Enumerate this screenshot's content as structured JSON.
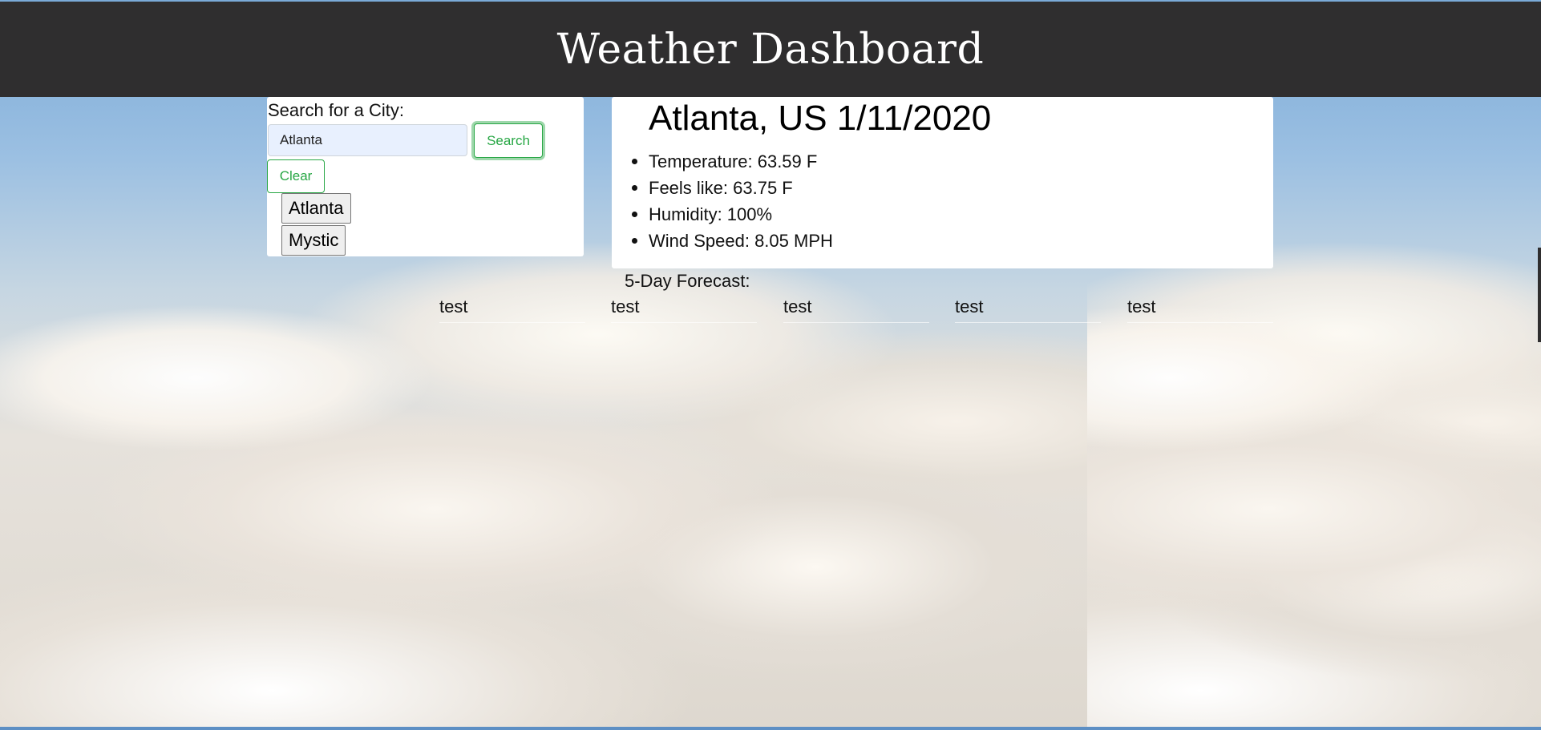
{
  "header": {
    "title": "Weather Dashboard"
  },
  "search": {
    "label": "Search for a City:",
    "input_value": "Atlanta",
    "search_label": "Search",
    "clear_label": "Clear",
    "history": [
      "Atlanta",
      "Mystic"
    ]
  },
  "current": {
    "title": "Atlanta, US 1/11/2020",
    "temperature": "Temperature: 63.59 F",
    "feels_like": "Feels like: 63.75 F",
    "humidity": "Humidity: 100%",
    "wind_speed": "Wind Speed: 8.05 MPH"
  },
  "forecast": {
    "label": "5-Day Forecast:",
    "days": [
      "test",
      "test",
      "test",
      "test",
      "test"
    ]
  },
  "colors": {
    "header_bg": "#2f2e2f",
    "accent_green": "#28a745",
    "input_bg": "#e8f0fe"
  }
}
